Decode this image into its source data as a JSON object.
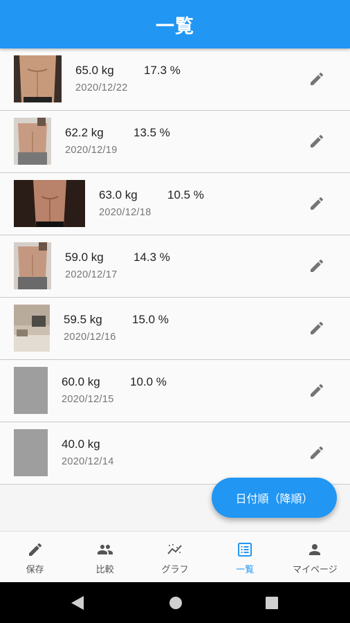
{
  "header": {
    "title": "一覧"
  },
  "entries": [
    {
      "weight": "65.0 kg",
      "fat": "17.3 %",
      "date": "2020/12/22",
      "photo": "photo"
    },
    {
      "weight": "62.2 kg",
      "fat": "13.5 %",
      "date": "2020/12/19",
      "photo": "photo"
    },
    {
      "weight": "63.0 kg",
      "fat": "10.5 %",
      "date": "2020/12/18",
      "photo": "photo"
    },
    {
      "weight": "59.0 kg",
      "fat": "14.3 %",
      "date": "2020/12/17",
      "photo": "photo"
    },
    {
      "weight": "59.5 kg",
      "fat": "15.0 %",
      "date": "2020/12/16",
      "photo": "photo"
    },
    {
      "weight": "60.0 kg",
      "fat": "10.0 %",
      "date": "2020/12/15",
      "photo": "placeholder"
    },
    {
      "weight": "40.0 kg",
      "fat": "",
      "date": "2020/12/14",
      "photo": "placeholder"
    }
  ],
  "fab": {
    "label": "日付順（降順）"
  },
  "bottom_nav": [
    {
      "label": "保存",
      "icon": "pencil-icon",
      "active": false
    },
    {
      "label": "比較",
      "icon": "people-icon",
      "active": false
    },
    {
      "label": "グラフ",
      "icon": "trend-chart-icon",
      "active": false
    },
    {
      "label": "一覧",
      "icon": "list-icon",
      "active": true
    },
    {
      "label": "マイページ",
      "icon": "person-icon",
      "active": false
    }
  ],
  "colors": {
    "primary": "#2196f3",
    "inactive_nav": "#555555",
    "placeholder_photo": "#9e9e9e"
  },
  "system_nav": [
    "back-icon",
    "home-icon",
    "recents-icon"
  ]
}
